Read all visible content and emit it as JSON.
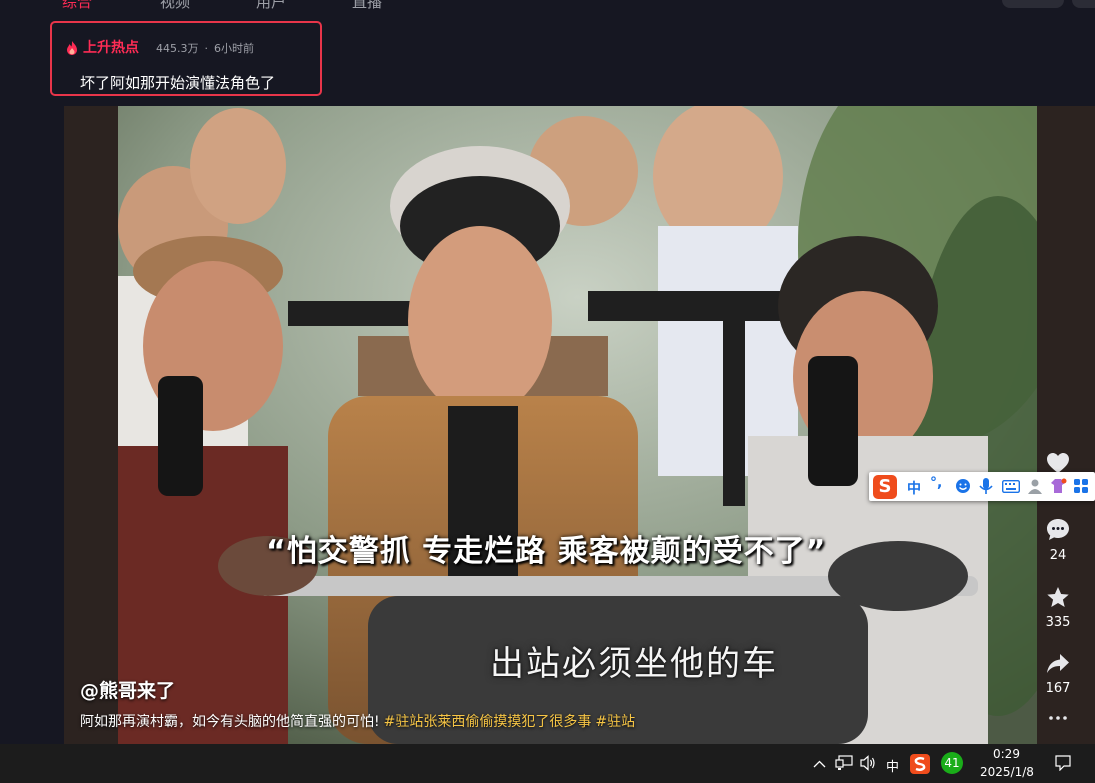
{
  "nav": {
    "tabs": [
      "综合",
      "视频",
      "用户",
      "直播"
    ]
  },
  "hot_topic": {
    "label": "上升热点",
    "views": "445.3万",
    "separator": "·",
    "time": "6小时前",
    "headline": "坏了阿如那开始演懂法角色了"
  },
  "video": {
    "subtitle_main": "“怕交警抓 专走烂路  乘客被颠的受不了”",
    "subtitle_caption": "出站必须坐他的车",
    "author": "@熊哥来了",
    "description": "阿如那再演村霸，如今有头脑的他简直强的可怕!",
    "tags": [
      "#驻站张莱西偷偷摸摸犯了很多事",
      "#驻站"
    ]
  },
  "actions": {
    "comments": "24",
    "favorites": "335",
    "shares": "167"
  },
  "ime": {
    "logo": "S",
    "lang": "中",
    "punct": "°,"
  },
  "taskbar": {
    "ime_lang": "中",
    "wechat_count": "41",
    "time": "0:29",
    "date": "2025/1/8"
  },
  "colors": {
    "background": "#161722",
    "accent": "#fe2c55",
    "highlight_border": "#e8354a",
    "tag_yellow": "#f6c545"
  },
  "icons": [
    "fire-icon",
    "heart-icon",
    "comment-icon",
    "star-icon",
    "share-icon",
    "more-icon",
    "sogou-icon",
    "emoji-icon",
    "mic-icon",
    "keyboard-icon",
    "skin-icon",
    "toolbox-icon",
    "chevron-up-icon",
    "network-icon",
    "volume-icon",
    "wechat-icon",
    "notification-icon"
  ]
}
